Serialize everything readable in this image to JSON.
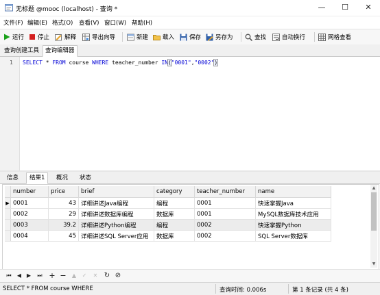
{
  "window": {
    "title": "无标题 @mooc (localhost) - 查询 *",
    "minimize": "—",
    "maximize": "☐",
    "close": "✕"
  },
  "menu": [
    {
      "label": "文件(F)"
    },
    {
      "label": "编辑(E)"
    },
    {
      "label": "格式(O)"
    },
    {
      "label": "查看(V)"
    },
    {
      "label": "窗口(W)"
    },
    {
      "label": "帮助(H)"
    }
  ],
  "toolbar": {
    "run": "运行",
    "stop": "停止",
    "explain": "解释",
    "export_wizard": "导出向导",
    "new": "新建",
    "load": "载入",
    "save": "保存",
    "save_as": "另存为",
    "find": "查找",
    "word_wrap": "自动换行",
    "grid_view": "网格查看"
  },
  "editor_tabs": {
    "query_builder": "查询创建工具",
    "query_editor": "查询编辑器"
  },
  "editor": {
    "line_number": "1",
    "kw_select": "SELECT",
    "star": " * ",
    "kw_from": "FROM",
    "table_name": " course ",
    "kw_where": "WHERE",
    "column": " teacher_number ",
    "kw_in": "IN",
    "open_paren": "(",
    "str1": "\"0001\"",
    "comma": ",",
    "str2": "\"0002\"",
    "close_paren": ")"
  },
  "result_tabs": {
    "info": "信息",
    "result1": "结果1",
    "profile": "概况",
    "status": "状态"
  },
  "grid": {
    "columns": [
      "number",
      "price",
      "brief",
      "category",
      "teacher_number",
      "name"
    ],
    "rows": [
      [
        "0001",
        "43",
        "详细讲述Java编程",
        "编程",
        "0001",
        "快速掌握Java"
      ],
      [
        "0002",
        "29",
        "详细讲述数据库编程",
        "数据库",
        "0001",
        "MySQL数据库技术应用"
      ],
      [
        "0003",
        "39.2",
        "详细讲述Python编程",
        "编程",
        "0002",
        "快速掌握Python"
      ],
      [
        "0004",
        "45",
        "详细讲述SQL Server应用",
        "数据库",
        "0002",
        "SQL Server数据库"
      ]
    ],
    "current_row_marker": "▶"
  },
  "nav": {
    "first": "⏮",
    "prev": "◀",
    "next": "▶",
    "last": "⏭",
    "add": "+",
    "delete": "−",
    "apply": "▲",
    "apply_check": "✓",
    "cancel": "✕",
    "refresh": "↻",
    "stop": "⊘"
  },
  "status": {
    "sql": "SELECT * FROM course WHERE",
    "query_time": "查询时间: 0.006s",
    "record": "第 1 条记录 (共 4 条)"
  },
  "colors": {
    "keyword": "#0000d6",
    "run_green": "#1aa11a",
    "stop_red": "#d42020"
  }
}
